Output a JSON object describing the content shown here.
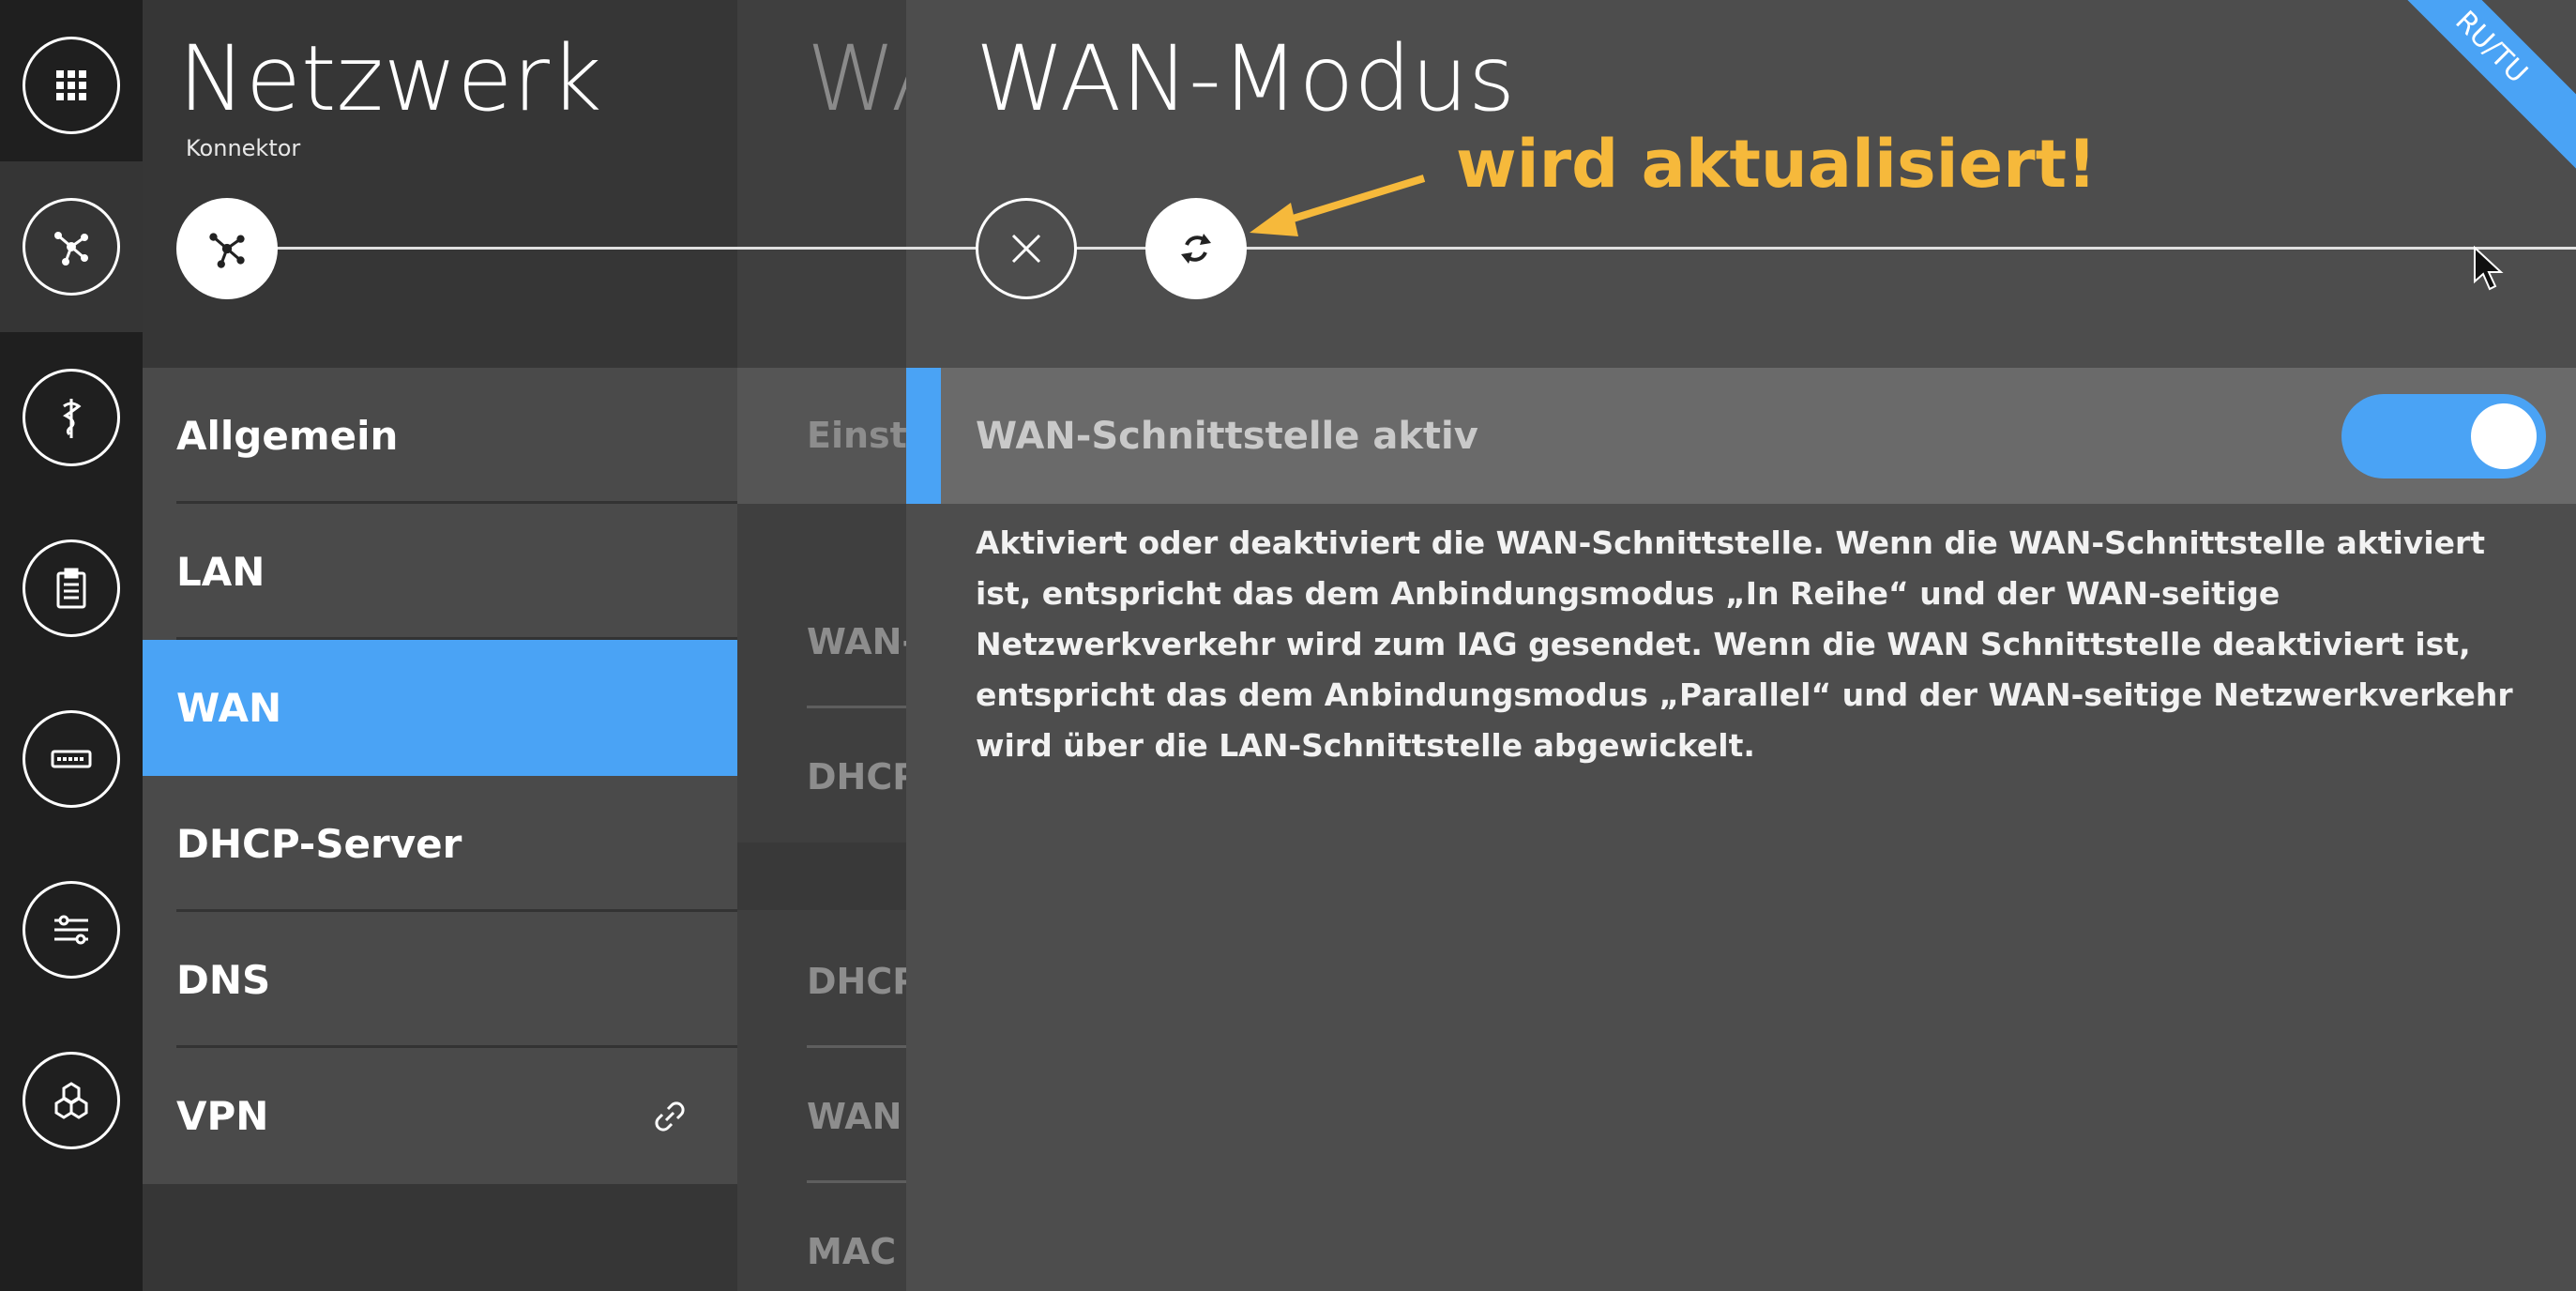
{
  "rail": {
    "items": [
      {
        "icon": "apps-grid-icon"
      },
      {
        "icon": "network-icon"
      },
      {
        "icon": "medical-icon"
      },
      {
        "icon": "clipboard-icon"
      },
      {
        "icon": "connector-device-icon"
      },
      {
        "icon": "transfer-settings-icon"
      },
      {
        "icon": "hexagons-icon"
      }
    ]
  },
  "col1": {
    "title": "Netzwerk",
    "subtitle": "Konnektor",
    "menu": [
      {
        "label": "Allgemein"
      },
      {
        "label": "LAN"
      },
      {
        "label": "WAN",
        "active": true
      },
      {
        "label": "DHCP-Server"
      },
      {
        "label": "DNS"
      },
      {
        "label": "VPN",
        "icon": "link-icon"
      }
    ]
  },
  "col2": {
    "title": "WAN",
    "rows": [
      "Einstellungen",
      "WAN-Modus",
      "DHCP",
      "DHCP",
      "WAN IP",
      "MAC"
    ]
  },
  "main": {
    "title": "WAN-Modus",
    "annotation": "wird aktualisiert!",
    "ribbon": "RU/TU",
    "setting_label": "WAN-Schnittstelle aktiv",
    "toggle_on": true,
    "description": "Aktiviert oder deaktiviert die WAN-Schnittstelle. Wenn die WAN-Schnittstelle aktiviert ist, entspricht das dem Anbindungsmodus „In Reihe“ und der WAN-seitige Netzwerkverkehr wird zum IAG gesendet. Wenn die WAN Schnittstelle deaktiviert ist, entspricht das dem Anbindungsmodus „Parallel“ und der WAN-seitige Netzwerkverkehr wird über die LAN-Schnittstelle abgewickelt."
  },
  "colors": {
    "accent": "#4aa3f5",
    "annotation": "#f6b93b"
  }
}
